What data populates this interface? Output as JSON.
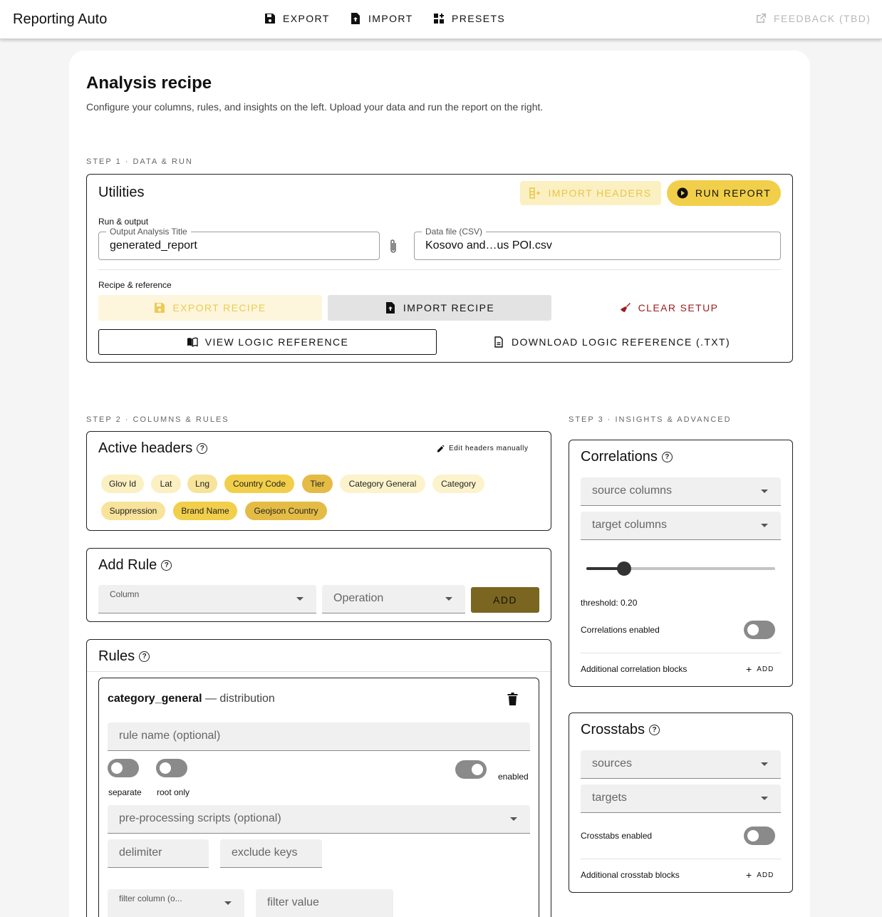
{
  "appbar": {
    "title": "Reporting Auto",
    "export": "EXPORT",
    "import": "IMPORT",
    "presets": "PRESETS",
    "feedback": "FEEDBACK (TBD)"
  },
  "header": {
    "title": "Analysis recipe",
    "subtitle": "Configure your columns, rules, and insights on the left. Upload your data and run the report on the right."
  },
  "step1": {
    "label": "STEP 1 · DATA & RUN",
    "utilities": {
      "title": "Utilities",
      "import_headers": "IMPORT HEADERS",
      "run_report": "RUN REPORT",
      "run_output_label": "Run & output",
      "output_title_legend": "Output Analysis Title",
      "output_title_value": "generated_report",
      "data_file_legend": "Data file (CSV)",
      "data_file_value": "Kosovo and…us POI.csv",
      "recipe_ref_label": "Recipe & reference",
      "export_recipe": "EXPORT RECIPE",
      "import_recipe": "IMPORT RECIPE",
      "clear_setup": "CLEAR SETUP",
      "view_logic": "VIEW LOGIC REFERENCE",
      "download_logic": "DOWNLOAD LOGIC REFERENCE (.TXT)"
    }
  },
  "step2": {
    "label": "STEP 2 · COLUMNS & RULES",
    "active_headers": {
      "title": "Active headers",
      "edit_manually": "Edit headers manually",
      "chips": [
        "Glov Id",
        "Lat",
        "Lng",
        "Country Code",
        "Tier",
        "Category General",
        "Category",
        "Suppression",
        "Brand Name",
        "Geojson Country"
      ]
    },
    "add_rule": {
      "title": "Add Rule",
      "column_label": "Column",
      "operation_placeholder": "Operation",
      "add": "ADD"
    },
    "rules": {
      "title": "Rules",
      "rule": {
        "column": "category_general",
        "separator": "—",
        "operation": "distribution",
        "name_placeholder": "rule name (optional)",
        "separate": "separate",
        "root_only": "root only",
        "enabled": "enabled",
        "preprocessing_placeholder": "pre-processing scripts (optional)",
        "delimiter_placeholder": "delimiter",
        "exclude_keys_placeholder": "exclude keys",
        "filter_column_placeholder": "filter column (o...",
        "filter_value_placeholder": "filter value"
      }
    }
  },
  "step3": {
    "label": "STEP 3 · INSIGHTS & ADVANCED",
    "correlations": {
      "title": "Correlations",
      "source_placeholder": "source columns",
      "target_placeholder": "target columns",
      "threshold": 0.2,
      "threshold_label": "threshold: 0.20",
      "enabled_label": "Correlations enabled",
      "additional_label": "Additional correlation blocks",
      "add": "ADD"
    },
    "crosstabs": {
      "title": "Crosstabs",
      "sources_placeholder": "sources",
      "targets_placeholder": "targets",
      "enabled_label": "Crosstabs enabled",
      "additional_label": "Additional crosstab blocks",
      "add": "ADD"
    }
  },
  "colors": {
    "accent": "#f2cf4a",
    "accent_light": "#fbf0c2",
    "olive": "#7a6620",
    "danger": "#9c1c1c"
  }
}
